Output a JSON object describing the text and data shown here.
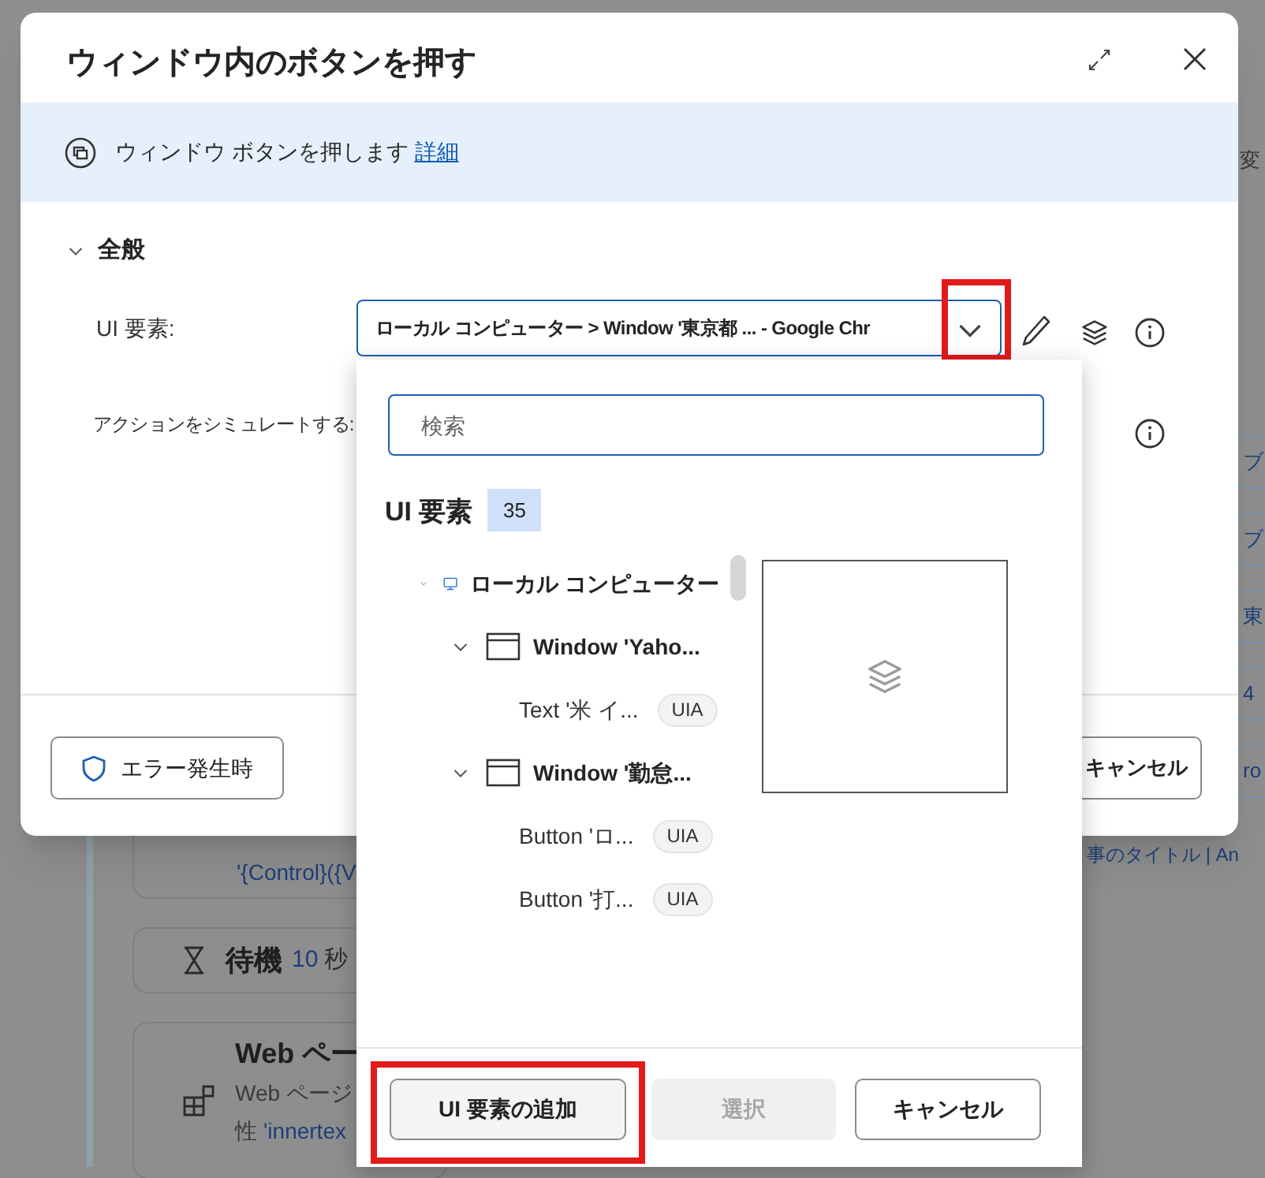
{
  "background": {
    "side_label": "変",
    "steps": [
      {
        "kind": "control",
        "text": "'{Control}({V"
      },
      {
        "kind": "wait",
        "title": "待機",
        "value": "10",
        "unit": "秒"
      },
      {
        "kind": "web",
        "title": "Web ペー",
        "line": "Web ページ",
        "detail_label": "性",
        "detail_value": "'innertex"
      }
    ],
    "chips": [
      "ブ",
      "ブ",
      "東",
      "4",
      "ro"
    ],
    "footer_text": "事のタイトル | An"
  },
  "dialog": {
    "title": "ウィンドウ内のボタンを押す",
    "info": {
      "text": "ウィンドウ ボタンを押します",
      "link": "詳細"
    },
    "section": {
      "label": "全般",
      "expanded": true
    },
    "ui_element": {
      "label": "UI 要素:",
      "value": "ローカル コンピューター > Window '東京都 ...  - Google Chr",
      "highlighted": true,
      "open": true
    },
    "simulate": {
      "label": "アクションをシミュレートする:"
    },
    "error_button": "エラー発生時",
    "cancel_button": "キャンセル"
  },
  "picker": {
    "search": {
      "placeholder": "検索"
    },
    "heading": "UI 要素",
    "count": "35",
    "tree": [
      {
        "kind": "computer",
        "label": "ローカル コンピューター",
        "expanded": true,
        "children": [
          {
            "kind": "window",
            "label": "Window 'Yaho...",
            "expanded": true,
            "children": [
              {
                "kind": "element",
                "label": "Text '米 イ...",
                "badge": "UIA"
              }
            ]
          },
          {
            "kind": "window",
            "label": "Window '勤怠...",
            "expanded": true,
            "children": [
              {
                "kind": "element",
                "label": "Button 'ロ...",
                "badge": "UIA"
              },
              {
                "kind": "element",
                "label": "Button '打...",
                "badge": "UIA"
              }
            ]
          }
        ]
      }
    ],
    "buttons": [
      {
        "label": "UI 要素の追加",
        "disabled": false,
        "highlighted": true
      },
      {
        "label": "選択",
        "disabled": true,
        "highlighted": false
      },
      {
        "label": "キャンセル",
        "disabled": false,
        "highlighted": false
      }
    ]
  }
}
